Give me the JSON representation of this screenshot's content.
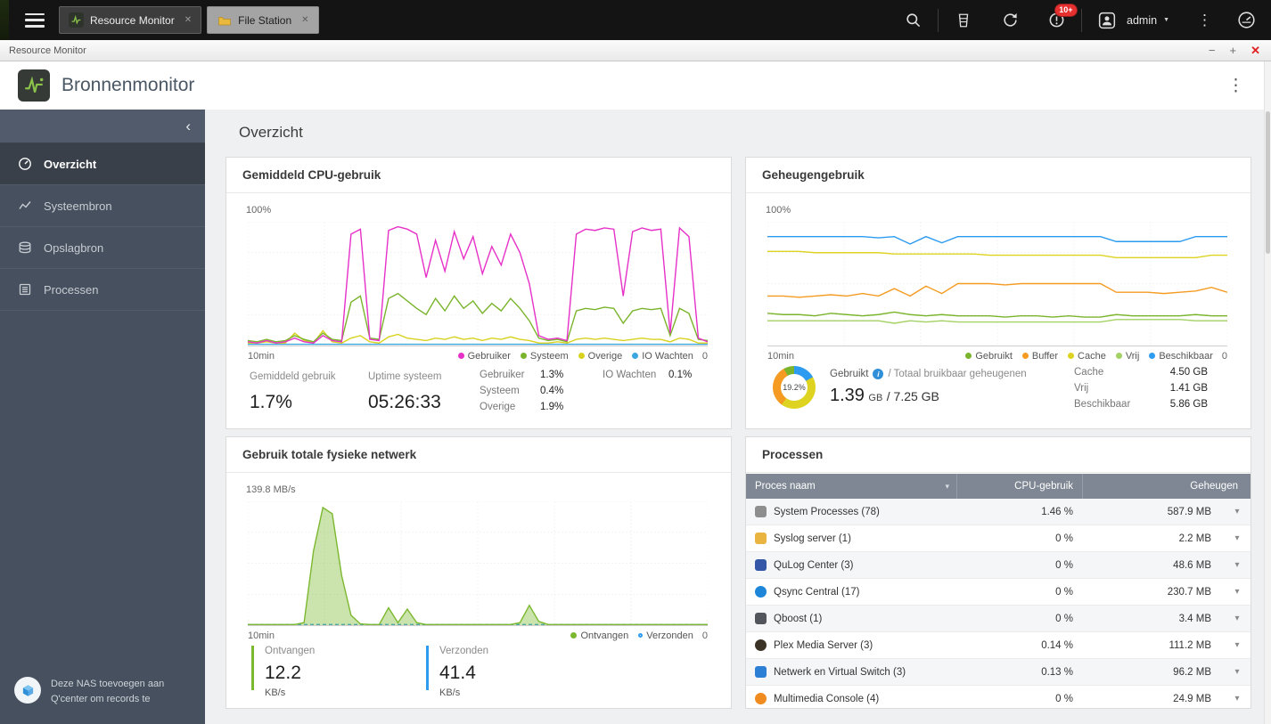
{
  "glyphs": {
    "close": "✕",
    "minimize": "−",
    "maximize": "+",
    "dots": "⋮",
    "chevron_left": "‹",
    "caret_small": "▼",
    "caret_down": "▾",
    "info": "i"
  },
  "topbar": {
    "tabs": [
      {
        "label": "Resource Monitor"
      },
      {
        "label": "File Station"
      }
    ],
    "user_label": "admin",
    "notification_badge": "10+"
  },
  "titlebar": {
    "title": "Resource Monitor"
  },
  "app": {
    "title": "Bronnenmonitor"
  },
  "sidebar": {
    "items": [
      {
        "label": "Overzicht"
      },
      {
        "label": "Systeembron"
      },
      {
        "label": "Opslagbron"
      },
      {
        "label": "Processen"
      }
    ],
    "footer": "Deze NAS toevoegen aan Q'center om records te"
  },
  "page_title": "Overzicht",
  "cpu": {
    "title": "Gemiddeld CPU-gebruik",
    "y_max": "100%",
    "x_left": "10min",
    "x_right": "0",
    "stats": {
      "avg_label": "Gemiddeld gebruik",
      "avg_value": "1.7%",
      "uptime_label": "Uptime systeem",
      "uptime_value": "05:26:33",
      "user_label": "Gebruiker",
      "user_value": "1.3%",
      "system_label": "Systeem",
      "system_value": "0.4%",
      "other_label": "Overige",
      "other_value": "1.9%",
      "io_label": "IO Wachten",
      "io_value": "0.1%"
    }
  },
  "memory": {
    "title": "Geheugengebruik",
    "y_max": "100%",
    "x_left": "10min",
    "x_right": "0",
    "donut": {
      "label": "19.2%",
      "segments": [
        {
          "color": "#2d9bf0",
          "from": 0,
          "to": 17
        },
        {
          "color": "#ddd320",
          "from": 17,
          "to": 60
        },
        {
          "color": "#f59b22",
          "from": 60,
          "to": 92
        },
        {
          "color": "#7ab42c",
          "from": 92,
          "to": 100
        }
      ]
    },
    "used_label": "Gebruikt",
    "total_label": "/ Totaal bruikbaar geheugenen",
    "used_value": "1.39",
    "used_unit": "GB",
    "total_value": " / 7.25 GB",
    "rows": [
      {
        "label": "Cache",
        "value": "4.50 GB"
      },
      {
        "label": "Vrij",
        "value": "1.41 GB"
      },
      {
        "label": "Beschikbaar",
        "value": "5.86 GB"
      }
    ]
  },
  "network": {
    "title": "Gebruik totale fysieke netwerk",
    "y_max": "139.8 MB/s",
    "x_left": "10min",
    "x_right": "0",
    "rx_label": "Ontvangen",
    "rx_value": "12.2",
    "rx_unit": "KB/s",
    "tx_label": "Verzonden",
    "tx_value": "41.4",
    "tx_unit": "KB/s"
  },
  "chart_data": [
    {
      "id": "cpu",
      "type": "line",
      "title": "Gemiddeld CPU-gebruik",
      "ylim": [
        0,
        100
      ],
      "y_max_label": "100%",
      "x_left_label": "10min",
      "x_right_label": "0",
      "grid": true,
      "legend_position": "bottom-right",
      "series": [
        {
          "name": "Gebruiker",
          "color": "#e631c8",
          "values": [
            3,
            2,
            4,
            2,
            3,
            6,
            3,
            2,
            8,
            4,
            3,
            90,
            94,
            5,
            4,
            93,
            96,
            94,
            90,
            55,
            85,
            60,
            92,
            70,
            88,
            58,
            80,
            65,
            90,
            75,
            50,
            8,
            5,
            6,
            4,
            90,
            94,
            93,
            95,
            94,
            40,
            92,
            95,
            93,
            94,
            10,
            95,
            88,
            6,
            3
          ]
        },
        {
          "name": "Systeem",
          "color": "#7ab42c",
          "values": [
            4,
            3,
            5,
            3,
            4,
            8,
            5,
            3,
            10,
            5,
            4,
            35,
            40,
            6,
            5,
            38,
            42,
            36,
            30,
            25,
            38,
            28,
            40,
            30,
            36,
            26,
            34,
            28,
            38,
            30,
            20,
            6,
            4,
            5,
            3,
            28,
            30,
            29,
            31,
            30,
            18,
            28,
            30,
            29,
            30,
            8,
            30,
            26,
            5,
            4
          ]
        },
        {
          "name": "Overige",
          "color": "#d8d21f",
          "values": [
            2,
            2,
            3,
            2,
            2,
            10,
            4,
            2,
            12,
            3,
            2,
            6,
            8,
            3,
            2,
            7,
            9,
            6,
            5,
            4,
            6,
            5,
            7,
            5,
            6,
            4,
            6,
            5,
            7,
            5,
            4,
            2,
            2,
            3,
            2,
            5,
            6,
            5,
            6,
            5,
            4,
            5,
            6,
            5,
            5,
            3,
            6,
            5,
            2,
            2
          ]
        },
        {
          "name": "IO Wachten",
          "color": "#3aa7e0",
          "values": [
            1,
            1,
            1,
            1,
            1,
            1,
            1,
            1,
            1,
            1,
            1,
            1,
            1,
            1,
            1,
            1,
            1,
            1,
            1,
            1,
            1,
            1,
            1,
            1,
            1,
            1,
            1,
            1,
            1,
            1,
            1,
            1,
            1,
            1,
            1,
            1,
            1,
            1,
            1,
            1,
            1,
            1,
            1,
            1,
            1,
            1,
            1,
            1,
            1,
            1
          ]
        }
      ]
    },
    {
      "id": "memory",
      "type": "line",
      "title": "Geheugengebruik",
      "ylim": [
        0,
        100
      ],
      "y_max_label": "100%",
      "x_left_label": "10min",
      "x_right_label": "0",
      "grid": true,
      "legend_position": "bottom-right",
      "series": [
        {
          "name": "Gebruikt",
          "color": "#7ab42c",
          "values": [
            26,
            25,
            25,
            24,
            26,
            25,
            24,
            25,
            27,
            25,
            24,
            25,
            24,
            24,
            24,
            23,
            24,
            24,
            23,
            24,
            23,
            23,
            25,
            24,
            24,
            24,
            24,
            25,
            24,
            24
          ]
        },
        {
          "name": "Buffer",
          "color": "#f59b22",
          "values": [
            40,
            40,
            39,
            40,
            41,
            40,
            42,
            40,
            46,
            40,
            48,
            42,
            50,
            50,
            50,
            49,
            50,
            50,
            50,
            50,
            50,
            50,
            43,
            43,
            43,
            42,
            43,
            44,
            47,
            43
          ]
        },
        {
          "name": "Cache",
          "color": "#ddd320",
          "values": [
            76,
            76,
            76,
            75,
            75,
            75,
            75,
            75,
            74,
            74,
            74,
            74,
            74,
            74,
            73,
            73,
            73,
            73,
            73,
            73,
            73,
            73,
            71,
            71,
            71,
            71,
            71,
            71,
            73,
            73
          ]
        },
        {
          "name": "Vrij",
          "color": "#a3d163",
          "values": [
            20,
            20,
            20,
            20,
            20,
            20,
            20,
            20,
            18,
            20,
            19,
            20,
            19,
            19,
            19,
            19,
            19,
            19,
            19,
            19,
            19,
            19,
            21,
            21,
            21,
            21,
            21,
            20,
            20,
            20
          ]
        },
        {
          "name": "Beschikbaar",
          "color": "#2d9bf0",
          "values": [
            88,
            88,
            88,
            88,
            88,
            88,
            88,
            87,
            88,
            82,
            88,
            83,
            88,
            88,
            88,
            88,
            88,
            88,
            88,
            88,
            88,
            88,
            84,
            84,
            84,
            84,
            84,
            88,
            88,
            88
          ]
        }
      ]
    },
    {
      "id": "network",
      "type": "area",
      "title": "Gebruik totale fysieke netwerk",
      "ylim": [
        0,
        100
      ],
      "y_max_label": "139.8 MB/s",
      "x_left_label": "10min",
      "x_right_label": "0",
      "grid": true,
      "legend_position": "bottom-right",
      "series": [
        {
          "name": "Ontvangen",
          "color": "#7cb82f",
          "area": true,
          "values": [
            0.5,
            0.5,
            0.5,
            0.5,
            0.5,
            0.5,
            2,
            60,
            95,
            90,
            40,
            8,
            1,
            0.5,
            0.5,
            14,
            2,
            13,
            2,
            0.5,
            0.5,
            0.5,
            0.5,
            0.5,
            0.5,
            0.5,
            0.5,
            0.5,
            0.5,
            2,
            16,
            3,
            0.5,
            0.5,
            0.5,
            0.5,
            0.5,
            0.5,
            0.5,
            0.5,
            0.5,
            0.5,
            0.5,
            0.5,
            0.5,
            0.5,
            0.5,
            0.5,
            0.5,
            0.5
          ]
        },
        {
          "name": "Verzonden",
          "color": "#2d9bf0",
          "dashed": true,
          "marker": "hollow",
          "values": [
            0.5,
            0.5,
            0.5,
            0.5,
            0.5,
            0.5,
            0.5,
            0.5,
            0.5,
            0.5,
            0.5,
            0.5,
            0.5,
            0.5,
            0.5,
            0.5,
            0.5,
            0.5,
            0.5,
            0.5,
            0.5,
            0.5,
            0.5,
            0.5,
            0.5,
            0.5,
            0.5,
            0.5,
            0.5,
            0.5,
            0.5,
            0.5,
            0.5,
            0.5,
            0.5,
            0.5,
            0.5,
            0.5,
            0.5,
            0.5,
            0.5,
            0.5,
            0.5,
            0.5,
            0.5,
            0.5,
            0.5,
            0.5,
            0.5,
            0.5
          ]
        }
      ]
    },
    {
      "id": "processes",
      "type": "table",
      "title": "Processen",
      "headers": [
        "Proces naam",
        "CPU-gebruik",
        "Geheugen"
      ],
      "rows": [
        {
          "name": "System Processes (78)",
          "cpu": "1.46 %",
          "mem": "587.9 MB",
          "icon_color": "#8e8e8e",
          "round": false
        },
        {
          "name": "Syslog server (1)",
          "cpu": "0 %",
          "mem": "2.2 MB",
          "icon_color": "#e9b440",
          "round": false
        },
        {
          "name": "QuLog Center (3)",
          "cpu": "0 %",
          "mem": "48.6 MB",
          "icon_color": "#3457a8",
          "round": false
        },
        {
          "name": "Qsync Central (17)",
          "cpu": "0 %",
          "mem": "230.7 MB",
          "icon_color": "#1d86d8",
          "round": true
        },
        {
          "name": "Qboost (1)",
          "cpu": "0 %",
          "mem": "3.4 MB",
          "icon_color": "#52565c",
          "round": false
        },
        {
          "name": "Plex Media Server (3)",
          "cpu": "0.14 %",
          "mem": "111.2 MB",
          "icon_color": "#3b3326",
          "round": true
        },
        {
          "name": "Netwerk en Virtual Switch (3)",
          "cpu": "0.13 %",
          "mem": "96.2 MB",
          "icon_color": "#2b7fd4",
          "round": false
        },
        {
          "name": "Multimedia Console (4)",
          "cpu": "0 %",
          "mem": "24.9 MB",
          "icon_color": "#ef8b1f",
          "round": true
        }
      ]
    }
  ]
}
